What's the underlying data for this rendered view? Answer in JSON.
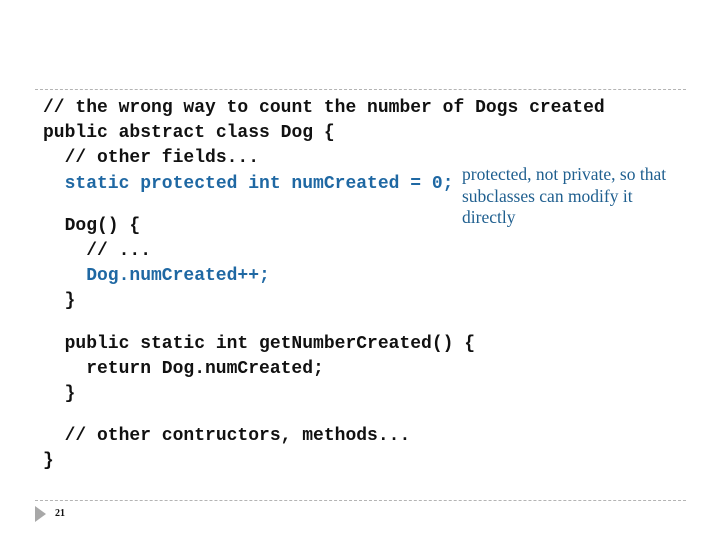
{
  "slide": {
    "code_lines": [
      {
        "text": "// the wrong way to count the number of Dogs created",
        "indent": 0,
        "highlight": false
      },
      {
        "text": "public abstract class Dog {",
        "indent": 0,
        "highlight": false
      },
      {
        "text": "// other fields...",
        "indent": 2,
        "highlight": false
      },
      {
        "text": "static protected int numCreated = 0;",
        "indent": 2,
        "highlight": true
      },
      {
        "text": "",
        "indent": 0,
        "highlight": false,
        "blank": true
      },
      {
        "text": "Dog() {",
        "indent": 2,
        "highlight": false
      },
      {
        "text": "// ...",
        "indent": 4,
        "highlight": false
      },
      {
        "text": "Dog.numCreated++;",
        "indent": 4,
        "highlight": true
      },
      {
        "text": "}",
        "indent": 2,
        "highlight": false
      },
      {
        "text": "",
        "indent": 0,
        "highlight": false,
        "blank": true
      },
      {
        "text": "public static int getNumberCreated() {",
        "indent": 2,
        "highlight": false
      },
      {
        "text": "return Dog.numCreated;",
        "indent": 4,
        "highlight": false
      },
      {
        "text": "}",
        "indent": 2,
        "highlight": false
      },
      {
        "text": "",
        "indent": 0,
        "highlight": false,
        "blank": true
      },
      {
        "text": "// other contructors, methods...",
        "indent": 2,
        "highlight": false
      },
      {
        "text": "}",
        "indent": 0,
        "highlight": false
      }
    ],
    "annotation": {
      "lines": [
        "protected, not private, so that",
        "subclasses can modify it",
        "directly"
      ]
    },
    "footer": {
      "bullet_icon": "triangle-right-icon",
      "page_number": "21"
    },
    "colors": {
      "code_text": "#111111",
      "code_highlight": "#1f68a3",
      "annotation": "#1f5f8f",
      "rule": "#b4b4b4",
      "bullet": "#a8a8a8"
    }
  }
}
